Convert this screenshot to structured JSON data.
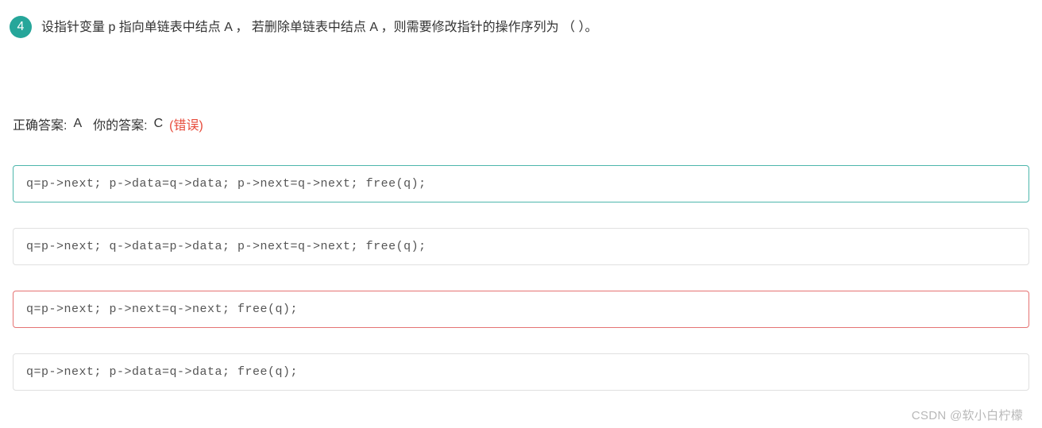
{
  "question": {
    "number": "4",
    "text": "设指针变量 p 指向单链表中结点 A ， 若删除单链表中结点 A ，则需要修改指针的操作序列为 （ ）。"
  },
  "answers": {
    "correct_label": "正确答案:",
    "correct_letter": "A",
    "your_label": "你的答案:",
    "your_letter": "C",
    "wrong_text": "(错误)"
  },
  "options": {
    "a": "q=p->next; p->data=q->data; p->next=q->next; free(q);",
    "b": "q=p->next; q->data=p->data; p->next=q->next; free(q);",
    "c": "q=p->next; p->next=q->next; free(q);",
    "d": "q=p->next; p->data=q->data; free(q);"
  },
  "watermark": "CSDN @软小白柠檬"
}
